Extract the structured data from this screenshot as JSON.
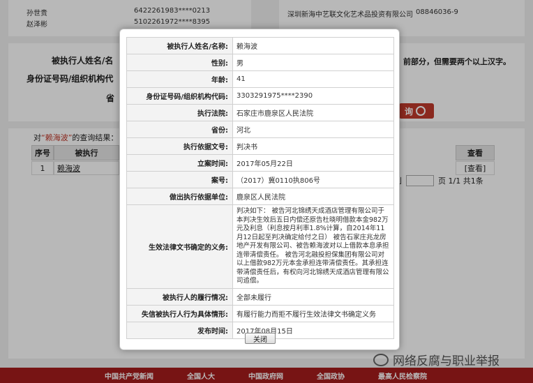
{
  "background": {
    "top_rows": [
      {
        "name": "孙世贵",
        "id": "6422261983****0213"
      },
      {
        "name": "赵泽彬",
        "id": "5102261972****8395"
      }
    ],
    "top_right_rows": [
      {
        "name": "深圳新海中艺联文化艺术品投资有限公司",
        "code": "08846036-9"
      }
    ],
    "form": {
      "name_label": "被执行人姓名/名",
      "id_label": "身份证号码/组织机构代",
      "province_label": "省",
      "hint": "前部分，但需要两个以上汉字。",
      "search_button": "询"
    },
    "results": {
      "prefix": "对",
      "keyword": "“赖海波”",
      "suffix": "的查询结果：",
      "headers": {
        "seq": "序号",
        "name": "被执行",
        "view": "查看"
      },
      "row": {
        "seq": "1",
        "name": "赖海波",
        "view": "[查看]"
      },
      "pager": {
        "prev": "到",
        "pages": "页 1/1 共1条"
      }
    },
    "footer_links": [
      "中国共产党新闻",
      "全国人大",
      "中国政府网",
      "全国政协",
      "最高人民检察院"
    ],
    "watermark": "网络反腐与职业举报"
  },
  "modal": {
    "rows": [
      {
        "label": "被执行人姓名/名称:",
        "value": "赖海波"
      },
      {
        "label": "性别:",
        "value": "男"
      },
      {
        "label": "年龄:",
        "value": "41"
      },
      {
        "label": "身份证号码/组织机构代码:",
        "value": "3303291975****2390"
      },
      {
        "label": "执行法院:",
        "value": "石家庄市鹿泉区人民法院"
      },
      {
        "label": "省份:",
        "value": "河北"
      },
      {
        "label": "执行依据文号:",
        "value": "判决书"
      },
      {
        "label": "立案时间:",
        "value": "2017年05月22日"
      },
      {
        "label": "案号:",
        "value": "（2017）冀0110执806号"
      },
      {
        "label": "做出执行依据单位:",
        "value": "鹿泉区人民法院"
      },
      {
        "label": "生效法律文书确定的义务:",
        "value": "判决如下： 被告河北锦绣天成酒店管理有限公司于本判决生效后五日内偿还原告杜晓明借款本金982万元及利息（利息按月利率1.8%计算，自2014年11月12日起至判决确定给付之日） 被告石家庄兆龙房地产开发有限公司、被告赖海波对以上借款本息承担连带清偿责任。 被告河北融投担保集团有限公司对以上借款982万元本金承担连带清偿责任。其承担连带清偿责任后，有权向河北锦绣天成酒店管理有限公司追偿。"
      },
      {
        "label": "被执行人的履行情况:",
        "value": "全部未履行"
      },
      {
        "label": "失信被执行人行为具体情形:",
        "value": "有履行能力而拒不履行生效法律文书确定义务"
      },
      {
        "label": "发布时间:",
        "value": "2017年08月15日"
      }
    ],
    "close_label": "关闭"
  }
}
